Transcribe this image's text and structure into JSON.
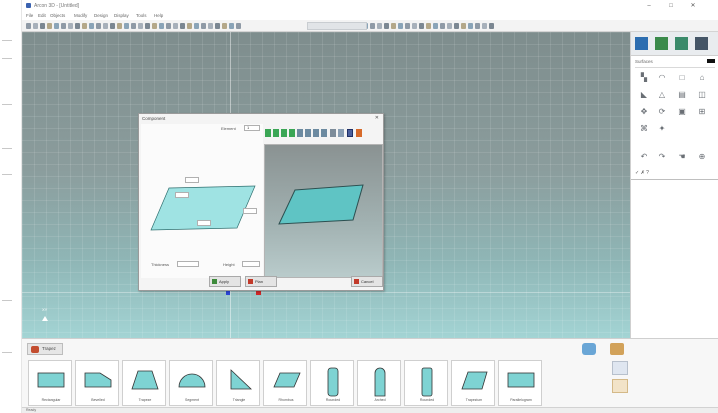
{
  "window": {
    "title": "Arcon 3D - [Untitled]",
    "controls": [
      "–",
      "□",
      "✕"
    ]
  },
  "menu": [
    "File",
    "Edit",
    "Objects",
    "Modify",
    "Design",
    "Display",
    "Tools",
    "Help"
  ],
  "toolbar": {
    "view_dropdown": "",
    "button_count": 58
  },
  "viewport": {
    "background_top": "#7e8d8d",
    "background_bottom": "#a3d4d4",
    "gizmo_label": "XY",
    "origin_label": ""
  },
  "dialog": {
    "title": "Component",
    "close": "✕",
    "top_field_label": "Element",
    "top_field_value": "1",
    "dimension_labels": [
      "",
      "",
      "",
      ""
    ],
    "dimension_values": [
      "",
      "",
      "",
      ""
    ],
    "bottom_field_1_label": "Thickness",
    "bottom_field_1_value": "",
    "bottom_field_2_label": "Height",
    "bottom_field_2_value": "",
    "buttons": {
      "ok": "Apply",
      "new": "Plan",
      "cancel": "Cancel"
    },
    "preview_fill": "#5fc4c4"
  },
  "right_panel": {
    "search_label": "Surfaces",
    "footer_text": "✓ ✗ ?"
  },
  "bottom_panel": {
    "tab_label": "Trapez",
    "shapes": [
      {
        "label": "Rectangular"
      },
      {
        "label": "Bevelled"
      },
      {
        "label": "Trapeze"
      },
      {
        "label": "Segment"
      },
      {
        "label": "Triangle"
      },
      {
        "label": "Rhombus"
      },
      {
        "label": "Rounded"
      },
      {
        "label": "Arched"
      },
      {
        "label": "Rounded"
      },
      {
        "label": "Trapezium"
      },
      {
        "label": "Parallelogram"
      }
    ]
  },
  "statusbar": {
    "left": "Ready",
    "coords": "",
    "items": [
      "",
      "",
      "",
      "",
      ""
    ]
  },
  "colors": {
    "accent_blue": "#2b46d6",
    "accent_red": "#d02727",
    "shape_fill": "#7ed3d3"
  }
}
